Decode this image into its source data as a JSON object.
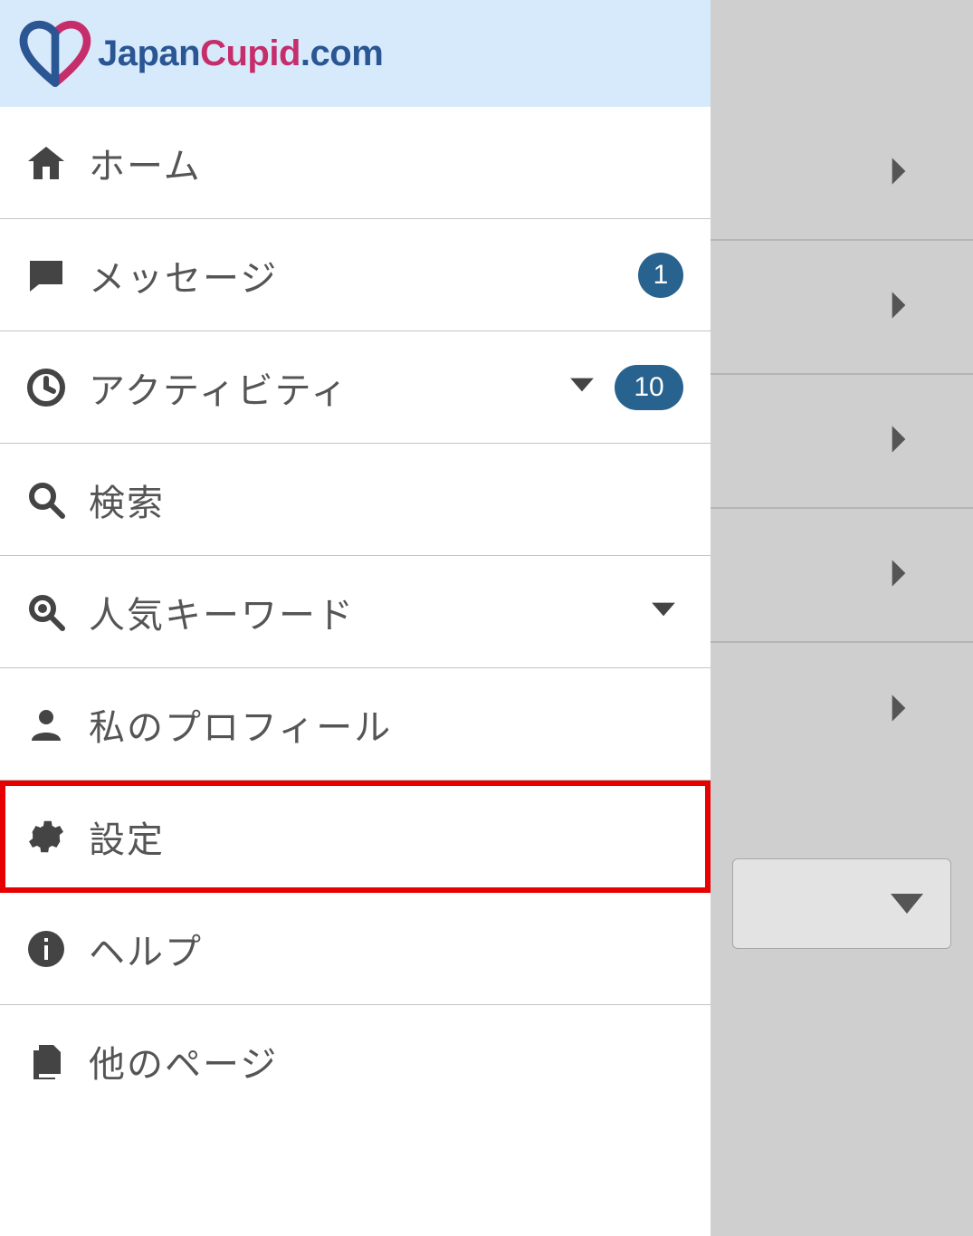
{
  "header": {
    "logo_parts": {
      "a": "Japan",
      "b": "Cupid",
      "c": ".com"
    }
  },
  "menu": {
    "items": [
      {
        "icon": "home",
        "label": "ホーム",
        "badge": null,
        "expandable": false,
        "highlighted": false
      },
      {
        "icon": "message",
        "label": "メッセージ",
        "badge": "1",
        "expandable": false,
        "highlighted": false
      },
      {
        "icon": "clock",
        "label": "アクティビティ",
        "badge": "10",
        "expandable": true,
        "highlighted": false
      },
      {
        "icon": "search",
        "label": "検索",
        "badge": null,
        "expandable": false,
        "highlighted": false
      },
      {
        "icon": "star-search",
        "label": "人気キーワード",
        "badge": null,
        "expandable": true,
        "highlighted": false
      },
      {
        "icon": "user",
        "label": "私のプロフィール",
        "badge": null,
        "expandable": false,
        "highlighted": false
      },
      {
        "icon": "gear",
        "label": "設定",
        "badge": null,
        "expandable": false,
        "highlighted": true
      },
      {
        "icon": "info",
        "label": "ヘルプ",
        "badge": null,
        "expandable": false,
        "highlighted": false
      },
      {
        "icon": "pages",
        "label": "他のページ",
        "badge": null,
        "expandable": false,
        "highlighted": false
      }
    ]
  },
  "side": {
    "rows": 5,
    "has_dropdown": true
  }
}
